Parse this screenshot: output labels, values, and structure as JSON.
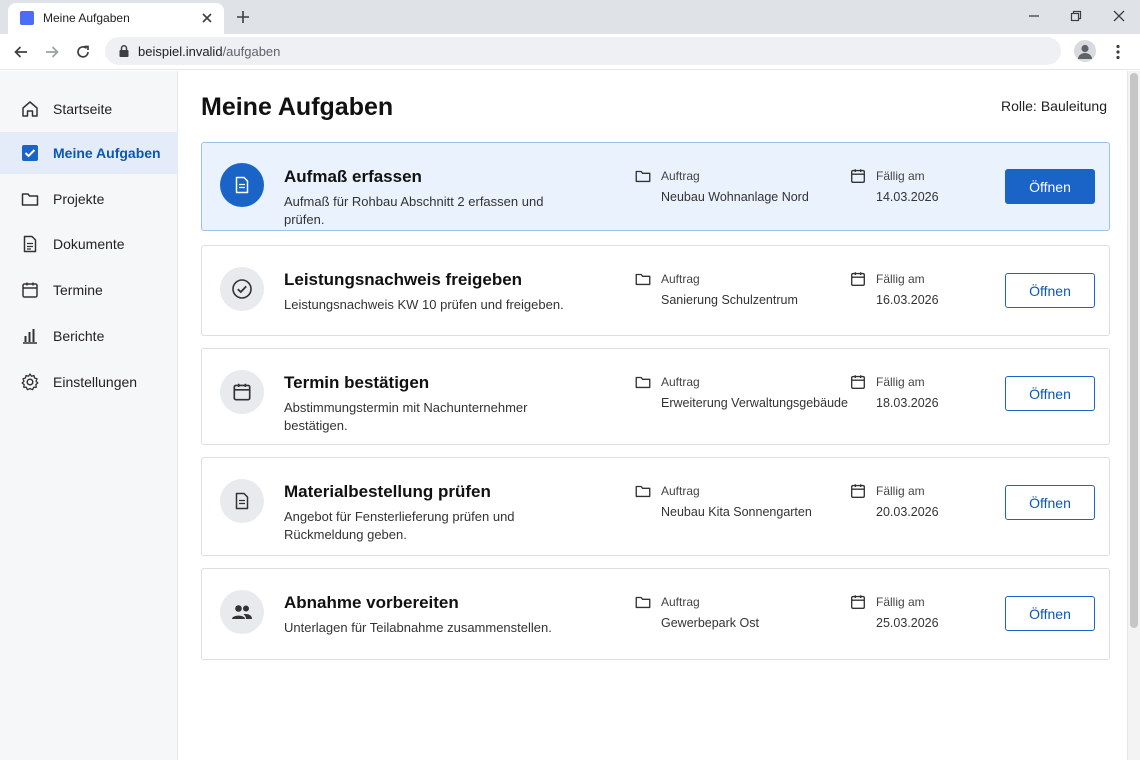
{
  "browser": {
    "tab_title": "Meine Aufgaben",
    "url_host": "beispiel.invalid",
    "url_path": "/aufgaben"
  },
  "sidebar": {
    "items": [
      {
        "label": "Startseite",
        "icon": "home-icon"
      },
      {
        "label": "Meine Aufgaben",
        "icon": "checkbox-icon",
        "active": true
      },
      {
        "label": "Projekte",
        "icon": "folder-icon"
      },
      {
        "label": "Dokumente",
        "icon": "document-icon"
      },
      {
        "label": "Termine",
        "icon": "calendar-icon"
      },
      {
        "label": "Berichte",
        "icon": "bar-chart-icon"
      },
      {
        "label": "Einstellungen",
        "icon": "gear-icon"
      }
    ]
  },
  "main": {
    "title": "Meine Aufgaben",
    "role_label": "Rolle:",
    "role_value": "Bauleitung"
  },
  "tasks": [
    {
      "title": "Aufmaß erfassen",
      "description": "Aufmaß für Rohbau Abschnitt 2 erfassen und prüfen.",
      "order_label": "Auftrag",
      "order": "Neubau Wohnanlage Nord",
      "due_label": "Fällig am",
      "due": "14.03.2026",
      "button": "Öffnen",
      "icon": "document-icon",
      "active": true
    },
    {
      "title": "Leistungsnachweis freigeben",
      "description": "Leistungsnachweis KW 10 prüfen und freigeben.",
      "order_label": "Auftrag",
      "order": "Sanierung Schulzentrum",
      "due_label": "Fällig am",
      "due": "16.03.2026",
      "button": "Öffnen",
      "icon": "check-circle-icon"
    },
    {
      "title": "Termin bestätigen",
      "description": "Abstimmungstermin mit Nachunternehmer bestätigen.",
      "order_label": "Auftrag",
      "order": "Erweiterung Verwaltungsgebäude",
      "due_label": "Fällig am",
      "due": "18.03.2026",
      "button": "Öffnen",
      "icon": "calendar-icon"
    },
    {
      "title": "Materialbestellung prüfen",
      "description": "Angebot für Fensterlieferung prüfen und Rückmeldung geben.",
      "order_label": "Auftrag",
      "order": "Neubau Kita Sonnengarten",
      "due_label": "Fällig am",
      "due": "20.03.2026",
      "button": "Öffnen",
      "icon": "document-icon"
    },
    {
      "title": "Abnahme vorbereiten",
      "description": "Unterlagen für Teilabnahme zusammenstellen.",
      "order_label": "Auftrag",
      "order": "Gewerbepark Ost",
      "due_label": "Fällig am",
      "due": "25.03.2026",
      "button": "Öffnen",
      "icon": "people-icon"
    }
  ],
  "colors": {
    "accent": "#1a64c8",
    "active_bg": "#eaf2fd",
    "sidebar_active_bg": "#e3ecf8"
  }
}
